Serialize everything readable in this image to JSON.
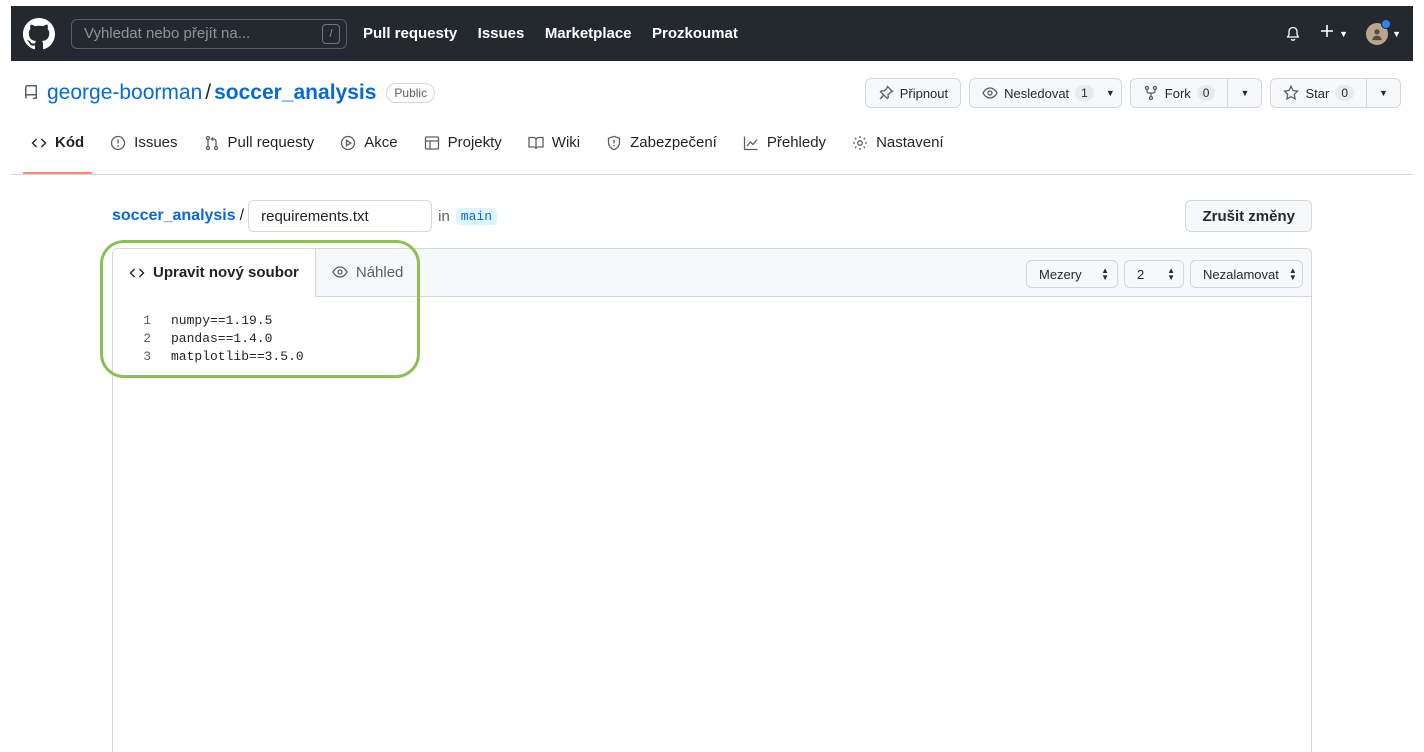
{
  "header": {
    "search_placeholder": "Vyhledat nebo přejít na...",
    "search_key": "/",
    "nav": [
      "Pull requesty",
      "Issues",
      "Marketplace",
      "Prozkoumat"
    ],
    "icons": [
      "github-logo-icon",
      "bell-icon",
      "plus-icon",
      "avatar"
    ]
  },
  "repo": {
    "owner": "george-boorman",
    "separator": "/",
    "name": "soccer_analysis",
    "visibility": "Public",
    "pin_label": "Připnout",
    "watch_label": "Nesledovat",
    "watch_count": "1",
    "fork_label": "Fork",
    "fork_count": "0",
    "star_label": "Star",
    "star_count": "0"
  },
  "tabs": [
    {
      "label": "Kód",
      "icon": "code-icon",
      "active": true
    },
    {
      "label": "Issues",
      "icon": "issue-opened-icon"
    },
    {
      "label": "Pull requesty",
      "icon": "git-pull-request-icon"
    },
    {
      "label": "Akce",
      "icon": "play-icon"
    },
    {
      "label": "Projekty",
      "icon": "table-icon"
    },
    {
      "label": "Wiki",
      "icon": "book-icon"
    },
    {
      "label": "Zabezpečení",
      "icon": "shield-icon"
    },
    {
      "label": "Přehledy",
      "icon": "graph-icon"
    },
    {
      "label": "Nastavení",
      "icon": "gear-icon"
    }
  ],
  "editor": {
    "path_repo": "soccer_analysis",
    "path_sep": "/",
    "filename": "requirements.txt",
    "in_text": "in",
    "branch": "main",
    "cancel_label": "Zrušit změny",
    "edit_tab": "Upravit nový soubor",
    "preview_tab": "Náhled",
    "indent_mode": "Mezery",
    "indent_size": "2",
    "wrap_mode": "Nezalamovat",
    "lines": [
      {
        "n": "1",
        "text": "numpy==1.19.5"
      },
      {
        "n": "2",
        "text": "pandas==1.4.0"
      },
      {
        "n": "3",
        "text": "matplotlib==3.5.0"
      }
    ]
  },
  "colors": {
    "header_bg": "#24292f",
    "link": "#0969da",
    "active_tab_underline": "#fd8c73",
    "highlight_ring": "#8cc152"
  }
}
